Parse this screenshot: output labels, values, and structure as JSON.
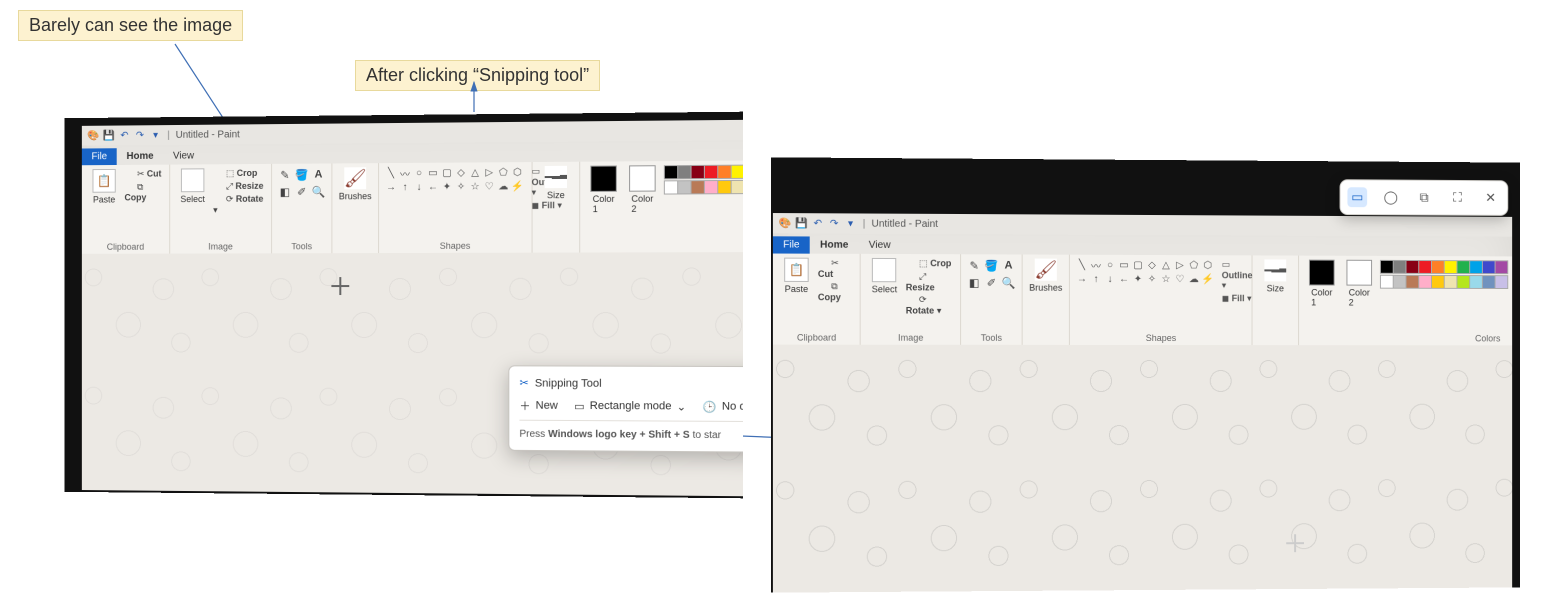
{
  "callouts": {
    "left": "Barely can see the image",
    "right": "After clicking “Snipping tool”"
  },
  "paint": {
    "title": "Untitled - Paint",
    "tabs": {
      "file": "File",
      "home": "Home",
      "view": "View"
    },
    "groups": {
      "clipboard": {
        "label": "Clipboard",
        "paste": "Paste",
        "cut": "Cut",
        "copy": "Copy"
      },
      "image": {
        "label": "Image",
        "select": "Select",
        "crop": "Crop",
        "resize": "Resize",
        "rotate": "Rotate"
      },
      "tools": {
        "label": "Tools"
      },
      "brushes": {
        "label": "Brushes"
      },
      "shapes": {
        "label": "Shapes",
        "outline": "Outline",
        "fill": "Fill"
      },
      "size": {
        "label": "Size"
      },
      "colors": {
        "label": "Colors",
        "c1": "Color\n1",
        "c2": "Color\n2"
      }
    }
  },
  "snip_popup": {
    "title": "Snipping Tool",
    "new": "New",
    "mode": "Rectangle mode",
    "delay": "No del",
    "hint_prefix": "Press ",
    "hint_key": "Windows logo key + Shift + S",
    "hint_suffix": " to star"
  },
  "palette_colors": [
    "#000",
    "#7f7f7f",
    "#880015",
    "#ed1c24",
    "#ff7f27",
    "#fff200",
    "#22b14c",
    "#00a2e8",
    "#3f48cc",
    "#a349a4",
    "#fff",
    "#c3c3c3",
    "#b97a57",
    "#ffaec9",
    "#ffc90e",
    "#efe4b0",
    "#b5e61d",
    "#99d9ea",
    "#7092be",
    "#c8bfe7"
  ]
}
